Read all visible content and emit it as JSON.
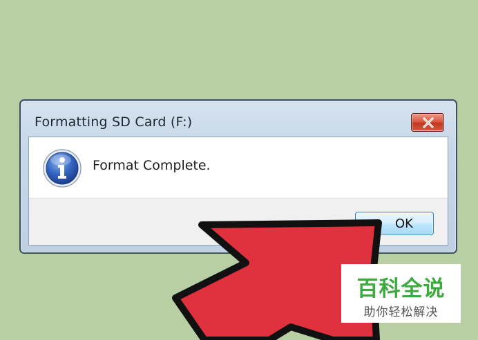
{
  "dialog": {
    "title": "Formatting SD Card (F:)",
    "message": "Format Complete.",
    "ok_label": "OK",
    "icon": "info-icon",
    "close_icon": "close-icon"
  },
  "overlay": {
    "arrow_color": "#e0313f",
    "arrow_outline": "#111111"
  },
  "watermark": {
    "title": "百科全说",
    "subtitle": "助你轻松解决"
  }
}
